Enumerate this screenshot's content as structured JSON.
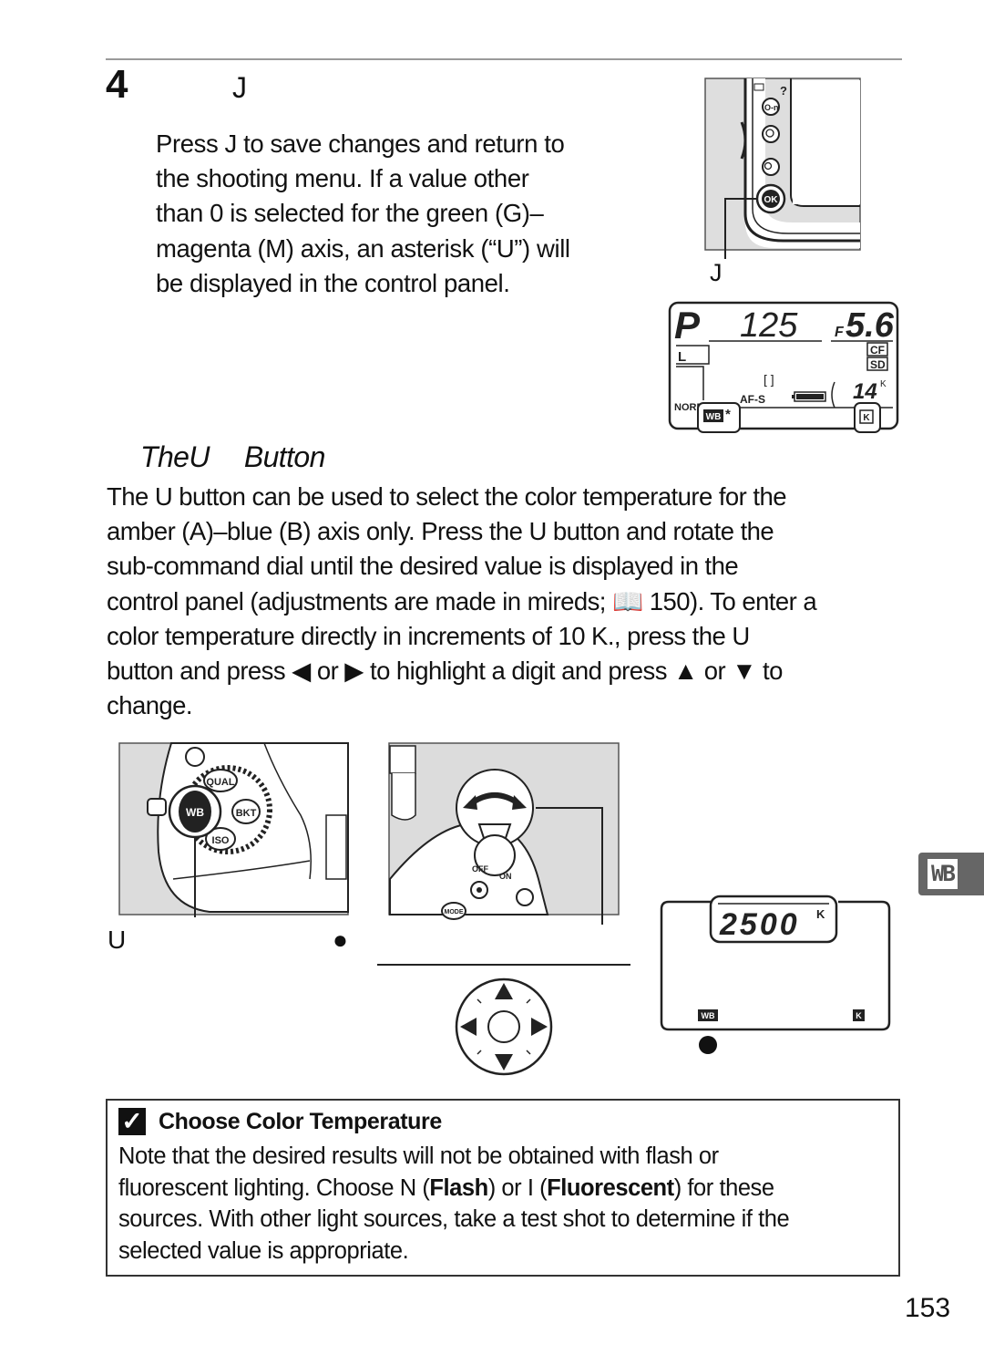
{
  "step": {
    "number": "4",
    "heading_glyph": "J",
    "body_lines": [
      "Press J  to save changes and return to",
      "the shooting menu.  If a value other",
      "than 0 is selected for the green (G)–",
      "magenta (M) axis, an asterisk (“U”) will",
      "be displayed in the control panel."
    ],
    "camera_back_figure": {
      "ok_button_label": "OK",
      "help_glyph": "?",
      "caption_glyph": "J"
    },
    "control_panel_figure": {
      "mode": "P",
      "shutter": "125",
      "aperture_prefix": "F",
      "aperture": "5.6",
      "cf_label": "CF",
      "sd_label": "SD",
      "image_size": "L",
      "image_quality": "NORM",
      "af_mode": "AF-S",
      "frames_remaining": "14",
      "k_superscript": "K",
      "wb_label": "WB",
      "asterisk": "*",
      "k_box_label": "K",
      "battery_level": 1.0
    }
  },
  "section": {
    "title_part1": "The",
    "title_glyph": "U",
    "title_part2": "Button",
    "body_lines": [
      "The U    button can be used to select the color temperature for the",
      "amber (A)–blue (B) axis only.  Press the U    button and rotate the",
      "sub-command dial until the desired value is displayed in the",
      "control panel (adjustments are made in mireds; 📖 150). To enter a",
      "color temperature directly in increments of 10 K., press the U",
      "button and press ◀ or ▶ to highlight a digit and press ▲ or ▼ to",
      "change."
    ]
  },
  "figures": {
    "wb_button": {
      "caption_glyph": "U",
      "dot_glyph": "●",
      "buttons": [
        "QUAL",
        "WB",
        "BKT",
        "ISO"
      ]
    },
    "sub_command_dial": {
      "switch_labels": [
        "OFF",
        "ON"
      ],
      "mode_label": "MODE"
    },
    "multi_selector": {
      "arrows": [
        "up",
        "down",
        "left",
        "right"
      ]
    },
    "color_temp_panel": {
      "value": "2500",
      "unit": "K",
      "wb_label": "WB",
      "k_box_label": "K",
      "dot_glyph": "●"
    }
  },
  "note": {
    "icon": "check-icon",
    "title": "Choose Color Temperature",
    "line1": "Note that the desired results will not be obtained with flash or",
    "line2_a": "fluorescent lighting.  Choose N (",
    "line2_flash": "Flash",
    "line2_b": ") or I    (",
    "line2_fluor": "Fluorescent",
    "line2_c": ") for these",
    "line3": "sources.  With other light sources, take a test shot to determine if the",
    "line4": "selected value is appropriate."
  },
  "side_tab": {
    "label": "WB",
    "color": "#666666"
  },
  "page_number": "153"
}
